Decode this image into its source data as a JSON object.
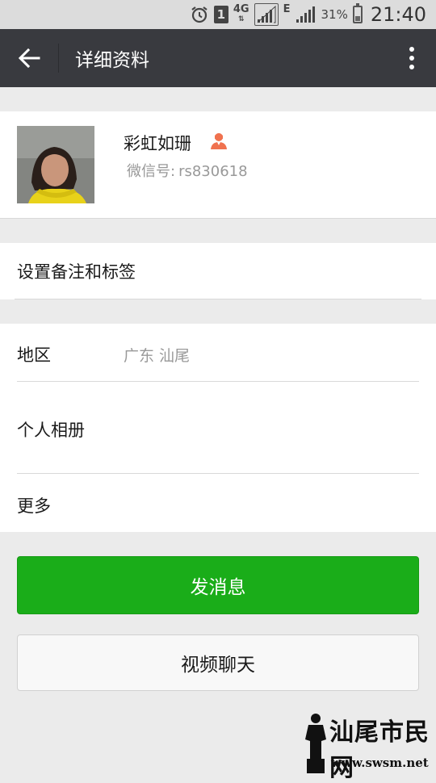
{
  "status_bar": {
    "sim": "1",
    "network": "4G",
    "data_letter": "E",
    "battery": "31%",
    "battery_level": 0.31,
    "time": "21:40"
  },
  "topbar": {
    "title": "详细资料"
  },
  "profile": {
    "name": "彩虹如珊",
    "wechat_id_label": "微信号:",
    "wechat_id": "rs830618",
    "gender_icon": "female-person-icon",
    "gender_color": "#f0724f"
  },
  "remark": {
    "label": "设置备注和标签"
  },
  "info": {
    "region_label": "地区",
    "region_value": "广东  汕尾",
    "album_label": "个人相册",
    "more_label": "更多"
  },
  "actions": {
    "send_message": "发消息",
    "video_chat": "视频聊天",
    "accent": "#1aad19"
  },
  "watermark": {
    "text": "汕尾市民网",
    "url": "www.swsm.net"
  }
}
